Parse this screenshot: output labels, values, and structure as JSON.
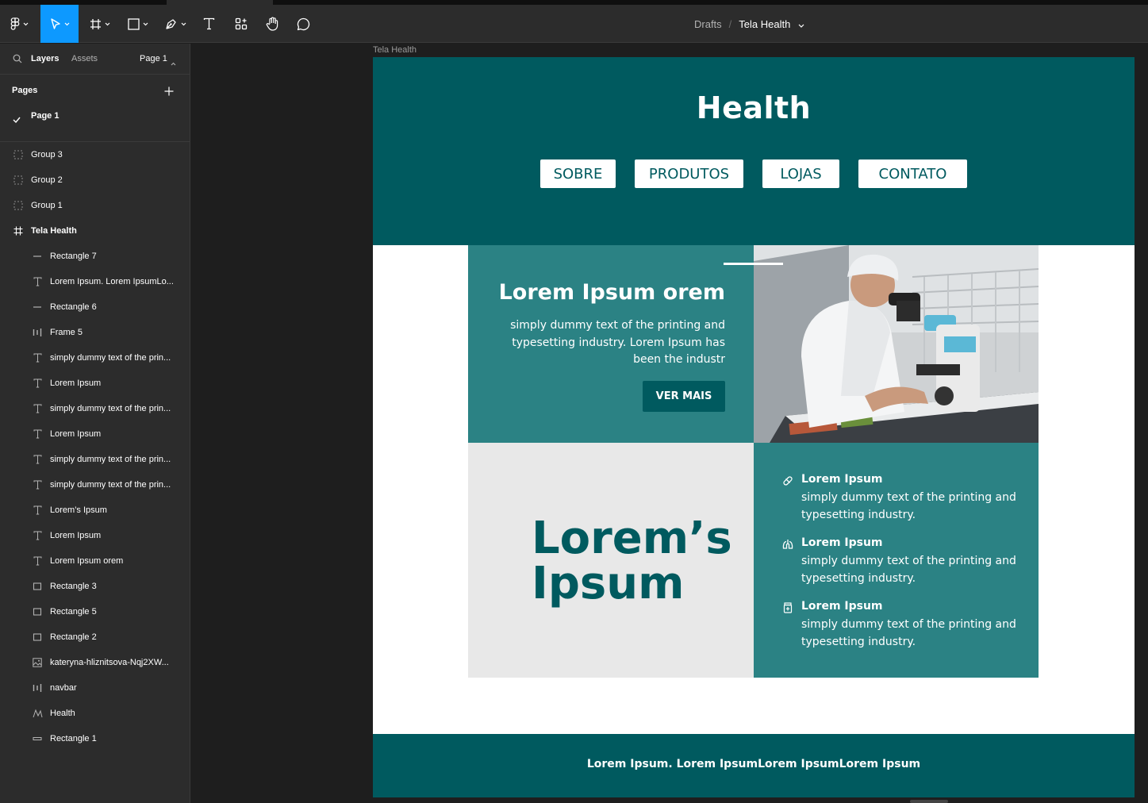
{
  "toolbar": {
    "tools": [
      "figma-menu",
      "move-tool",
      "frame-tool",
      "shape-tool",
      "pen-tool",
      "text-tool",
      "resources-tool",
      "hand-tool",
      "comment-tool"
    ],
    "active_tool": "move-tool"
  },
  "breadcrumb": {
    "drafts": "Drafts",
    "separator": "/",
    "file": "Tela Health"
  },
  "left_panel": {
    "tab_layers": "Layers",
    "tab_assets": "Assets",
    "page_selector": "Page 1",
    "pages_heading": "Pages",
    "current_page": "Page 1",
    "layers": [
      {
        "name": "Group 3",
        "icon": "group-icon",
        "level": 0
      },
      {
        "name": "Group 2",
        "icon": "group-icon",
        "level": 0
      },
      {
        "name": "Group 1",
        "icon": "group-icon",
        "level": 0
      },
      {
        "name": "Tela Health",
        "icon": "frame-icon",
        "level": 0
      },
      {
        "name": "Rectangle 7",
        "icon": "line-icon",
        "level": 1
      },
      {
        "name": "Lorem Ipsum. Lorem IpsumLo...",
        "icon": "text-icon",
        "level": 1
      },
      {
        "name": "Rectangle 6",
        "icon": "line-icon",
        "level": 1
      },
      {
        "name": "Frame 5",
        "icon": "autolayout-icon",
        "level": 1
      },
      {
        "name": "simply dummy text of the prin...",
        "icon": "text-icon",
        "level": 1
      },
      {
        "name": "Lorem Ipsum",
        "icon": "text-icon",
        "level": 1
      },
      {
        "name": "simply dummy text of the prin...",
        "icon": "text-icon",
        "level": 1
      },
      {
        "name": "Lorem Ipsum",
        "icon": "text-icon",
        "level": 1
      },
      {
        "name": "simply dummy text of the prin...",
        "icon": "text-icon",
        "level": 1
      },
      {
        "name": "simply dummy text of the prin...",
        "icon": "text-icon",
        "level": 1
      },
      {
        "name": "Lorem’s Ipsum",
        "icon": "text-icon",
        "level": 1
      },
      {
        "name": "Lorem Ipsum",
        "icon": "text-icon",
        "level": 1
      },
      {
        "name": "Lorem Ipsum orem",
        "icon": "text-icon",
        "level": 1
      },
      {
        "name": "Rectangle 3",
        "icon": "rectangle-icon",
        "level": 1
      },
      {
        "name": "Rectangle 5",
        "icon": "rectangle-icon",
        "level": 1
      },
      {
        "name": "Rectangle 2",
        "icon": "rectangle-icon",
        "level": 1
      },
      {
        "name": "kateryna-hliznitsova-Nqj2XW...",
        "icon": "image-icon",
        "level": 1
      },
      {
        "name": "navbar",
        "icon": "autolayout-icon",
        "level": 1
      },
      {
        "name": "Health",
        "icon": "vector-icon",
        "level": 1
      },
      {
        "name": "Rectangle 1",
        "icon": "thin-rectangle-icon",
        "level": 1
      }
    ]
  },
  "canvas": {
    "frame_label": "Tela Health",
    "design": {
      "brand": "Health",
      "nav": [
        "SOBRE",
        "PRODUTOS",
        "LOJAS",
        "CONTATO"
      ],
      "hero_title": "Lorem Ipsum orem",
      "hero_text": "simply dummy text of the printing and typesetting industry. Lorem Ipsum has been the industr",
      "hero_button": "VER MAIS",
      "big_title": "Lorem’s\nIpsum",
      "features": [
        {
          "icon": "pill-icon",
          "title": "Lorem Ipsum",
          "text": "simply dummy text of the printing and typesetting industry."
        },
        {
          "icon": "lungs-icon",
          "title": "Lorem Ipsum",
          "text": "simply dummy text of the printing and typesetting industry."
        },
        {
          "icon": "medicine-jar-icon",
          "title": "Lorem Ipsum",
          "text": "simply dummy text of the printing and typesetting industry."
        }
      ],
      "footer": "Lorem Ipsum. Lorem IpsumLorem IpsumLorem Ipsum"
    },
    "colors": {
      "dark_teal": "#005a5f",
      "teal": "#2b8284",
      "light_grey": "#e8e8e8",
      "figma_blue": "#0d99ff"
    }
  }
}
